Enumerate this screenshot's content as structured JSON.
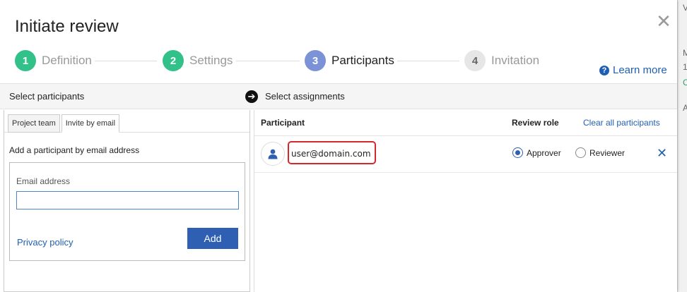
{
  "dialog": {
    "title": "Initiate review",
    "close_glyph": "✕",
    "learn_more": "Learn more"
  },
  "steps": [
    {
      "num": "1",
      "label": "Definition",
      "color": "#33c18a"
    },
    {
      "num": "2",
      "label": "Settings",
      "color": "#33c18a"
    },
    {
      "num": "3",
      "label": "Participants",
      "color": "#7b93d6"
    },
    {
      "num": "4",
      "label": "Invitation",
      "color": "#e6e6e6"
    }
  ],
  "sections": {
    "left": "Select participants",
    "right": "Select assignments"
  },
  "tabs": [
    {
      "label": "Project team"
    },
    {
      "label": "Invite by email"
    }
  ],
  "invite": {
    "heading": "Add a participant by email address",
    "email_label": "Email address",
    "email_value": "",
    "privacy_policy": "Privacy policy",
    "add_label": "Add"
  },
  "table": {
    "col_participant": "Participant",
    "col_role": "Review role",
    "clear_all": "Clear all participants"
  },
  "participants": [
    {
      "email": "user@domain.com",
      "roles": [
        "Approver",
        "Reviewer"
      ],
      "selected_role": "Approver"
    }
  ],
  "colors": {
    "accent": "#2f5fb3",
    "link": "#1f5fb3",
    "highlight": "#d9262c"
  }
}
